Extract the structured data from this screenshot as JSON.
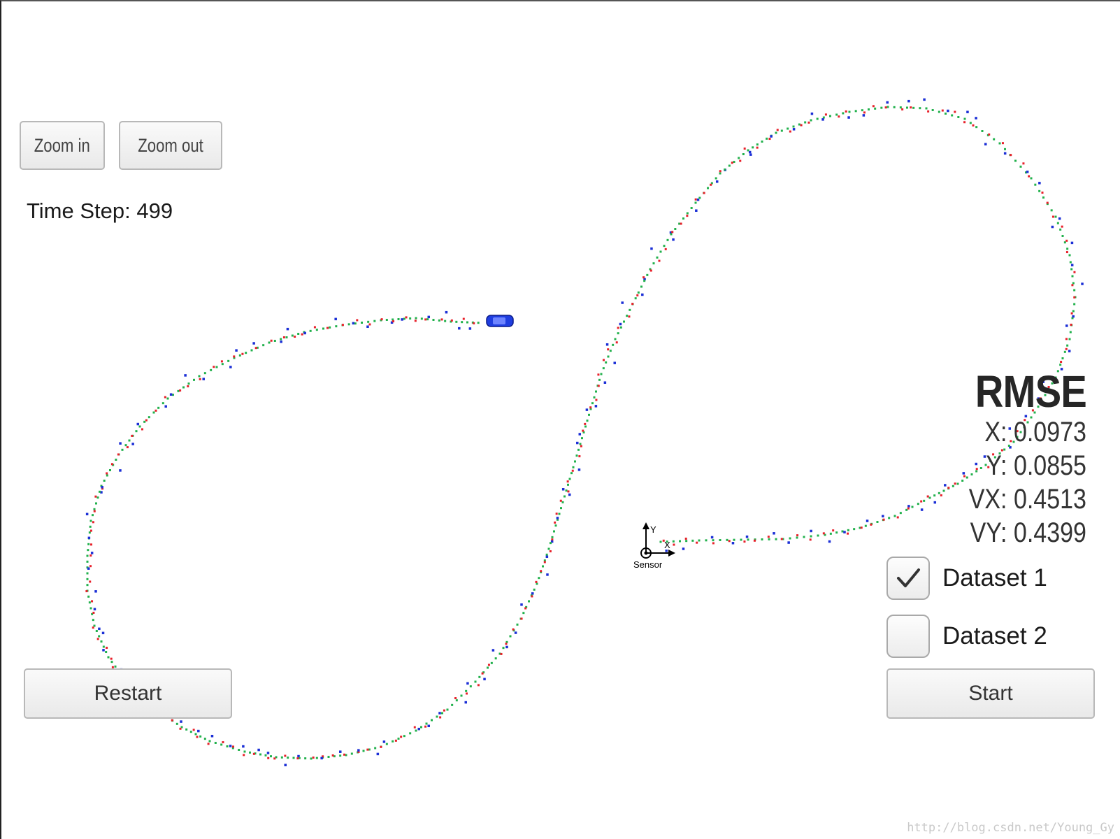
{
  "controls": {
    "zoom_in_label": "Zoom in",
    "zoom_out_label": "Zoom out",
    "restart_label": "Restart",
    "start_label": "Start"
  },
  "status": {
    "time_step_label": "Time Step: 499"
  },
  "rmse": {
    "title": "RMSE",
    "x": "X: 0.0973",
    "y": "Y: 0.0855",
    "vx": "VX: 0.4513",
    "vy": "VY: 0.4399"
  },
  "datasets": [
    {
      "label": "Dataset 1",
      "checked": true
    },
    {
      "label": "Dataset 2",
      "checked": false
    }
  ],
  "sensor": {
    "label": "Sensor",
    "axis_x": "X",
    "axis_y": "Y"
  },
  "colors": {
    "estimate": "#22b14c",
    "lidar": "#e8202a",
    "radar": "#1b2fd6",
    "car": "#1f3ee0"
  },
  "watermark": "http://blog.csdn.net/Young_Gy"
}
